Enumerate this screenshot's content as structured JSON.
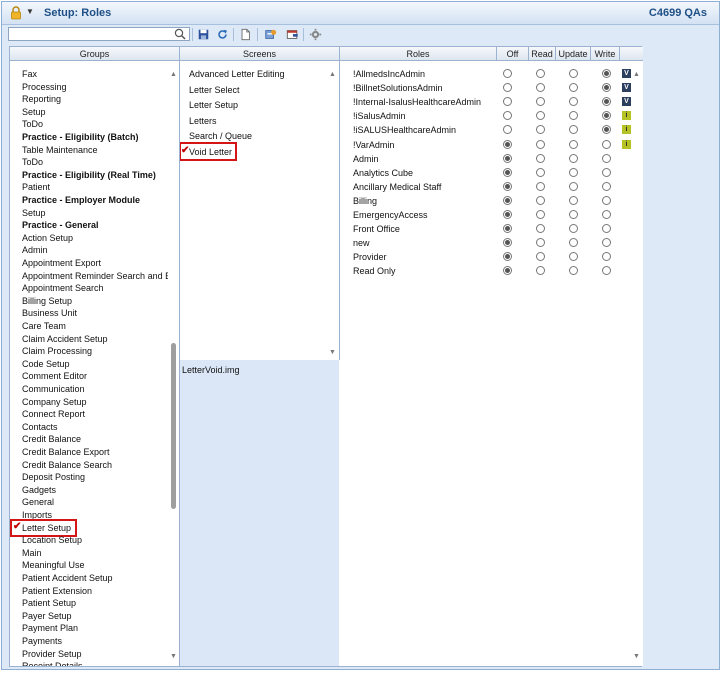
{
  "window": {
    "title": "Setup: Roles",
    "tenant": "C4699 QAs"
  },
  "toolbar": {
    "search": {
      "value": "",
      "placeholder": ""
    },
    "buttons": [
      {
        "icon": "search-icon"
      },
      {
        "icon": "save-icon"
      },
      {
        "icon": "refresh-icon"
      },
      {
        "icon": "new-document-icon"
      },
      {
        "icon": "edit-settings-icon"
      },
      {
        "icon": "export-icon"
      },
      {
        "icon": "gear-icon"
      }
    ]
  },
  "columns": {
    "groups": "Groups",
    "screens": "Screens",
    "roles": "Roles",
    "off": "Off",
    "read": "Read",
    "update": "Update",
    "write": "Write"
  },
  "groups": [
    {
      "label": "Fax",
      "bold": false
    },
    {
      "label": "Processing",
      "bold": false
    },
    {
      "label": "Reporting",
      "bold": false
    },
    {
      "label": "Setup",
      "bold": false
    },
    {
      "label": "ToDo",
      "bold": false
    },
    {
      "label": "Practice - Eligibility (Batch)",
      "bold": true
    },
    {
      "label": "Table Maintenance",
      "bold": false
    },
    {
      "label": "ToDo",
      "bold": false
    },
    {
      "label": "Practice - Eligibility (Real Time)",
      "bold": true
    },
    {
      "label": "Patient",
      "bold": false
    },
    {
      "label": "Practice - Employer Module",
      "bold": true
    },
    {
      "label": "Setup",
      "bold": false
    },
    {
      "label": "Practice - General",
      "bold": true
    },
    {
      "label": "Action Setup",
      "bold": false
    },
    {
      "label": "Admin",
      "bold": false
    },
    {
      "label": "Appointment Export",
      "bold": false
    },
    {
      "label": "Appointment Reminder Search and Exp",
      "bold": false
    },
    {
      "label": "Appointment Search",
      "bold": false
    },
    {
      "label": "Billing Setup",
      "bold": false
    },
    {
      "label": "Business Unit",
      "bold": false
    },
    {
      "label": "Care Team",
      "bold": false
    },
    {
      "label": "Claim Accident Setup",
      "bold": false
    },
    {
      "label": "Claim Processing",
      "bold": false
    },
    {
      "label": "Code Setup",
      "bold": false
    },
    {
      "label": "Comment Editor",
      "bold": false
    },
    {
      "label": "Communication",
      "bold": false
    },
    {
      "label": "Company Setup",
      "bold": false
    },
    {
      "label": "Connect Report",
      "bold": false
    },
    {
      "label": "Contacts",
      "bold": false
    },
    {
      "label": "Credit Balance",
      "bold": false
    },
    {
      "label": "Credit Balance Export",
      "bold": false
    },
    {
      "label": "Credit Balance Search",
      "bold": false
    },
    {
      "label": "Deposit Posting",
      "bold": false
    },
    {
      "label": "Gadgets",
      "bold": false
    },
    {
      "label": "General",
      "bold": false
    },
    {
      "label": "Imports",
      "bold": false
    },
    {
      "label": "Letter Setup",
      "bold": false,
      "checked": true
    },
    {
      "label": "Location Setup",
      "bold": false
    },
    {
      "label": "Main",
      "bold": false
    },
    {
      "label": "Meaningful Use",
      "bold": false
    },
    {
      "label": "Patient Accident Setup",
      "bold": false
    },
    {
      "label": "Patient Extension",
      "bold": false
    },
    {
      "label": "Patient Setup",
      "bold": false
    },
    {
      "label": "Payer Setup",
      "bold": false
    },
    {
      "label": "Payment Plan",
      "bold": false
    },
    {
      "label": "Payments",
      "bold": false
    },
    {
      "label": "Provider Setup",
      "bold": false
    },
    {
      "label": "Receipt Details",
      "bold": false
    }
  ],
  "screens": [
    {
      "label": "Advanced Letter Editing"
    },
    {
      "label": "Letter Select"
    },
    {
      "label": "Letter Setup"
    },
    {
      "label": "Letters"
    },
    {
      "label": "Search / Queue"
    },
    {
      "label": "Void Letter",
      "checked": true
    }
  ],
  "preview": {
    "filename": "LetterVoid.img"
  },
  "roles": [
    {
      "name": "!AllmedsIncAdmin",
      "access": "write",
      "badge": "V"
    },
    {
      "name": "!BillnetSolutionsAdmin",
      "access": "write",
      "badge": "V"
    },
    {
      "name": "!Internal-IsalusHealthcareAdmin",
      "access": "write",
      "badge": "V"
    },
    {
      "name": "!iSalusAdmin",
      "access": "write",
      "badge": "i"
    },
    {
      "name": "!iSALUSHealthcareAdmin",
      "access": "write",
      "badge": "i"
    },
    {
      "name": "!VarAdmin",
      "access": "off",
      "badge": "i"
    },
    {
      "name": "Admin",
      "access": "off",
      "badge": ""
    },
    {
      "name": "Analytics Cube",
      "access": "off",
      "badge": ""
    },
    {
      "name": "Ancillary Medical Staff",
      "access": "off",
      "badge": ""
    },
    {
      "name": "Billing",
      "access": "off",
      "badge": ""
    },
    {
      "name": "EmergencyAccess",
      "access": "off",
      "badge": ""
    },
    {
      "name": "Front Office",
      "access": "off",
      "badge": ""
    },
    {
      "name": "new",
      "access": "off",
      "badge": ""
    },
    {
      "name": "Provider",
      "access": "off",
      "badge": ""
    },
    {
      "name": "Read Only",
      "access": "off",
      "badge": ""
    }
  ],
  "colors": {
    "accent": "#1e4f86",
    "highlight_border": "#d31515",
    "check": "#c00000"
  }
}
